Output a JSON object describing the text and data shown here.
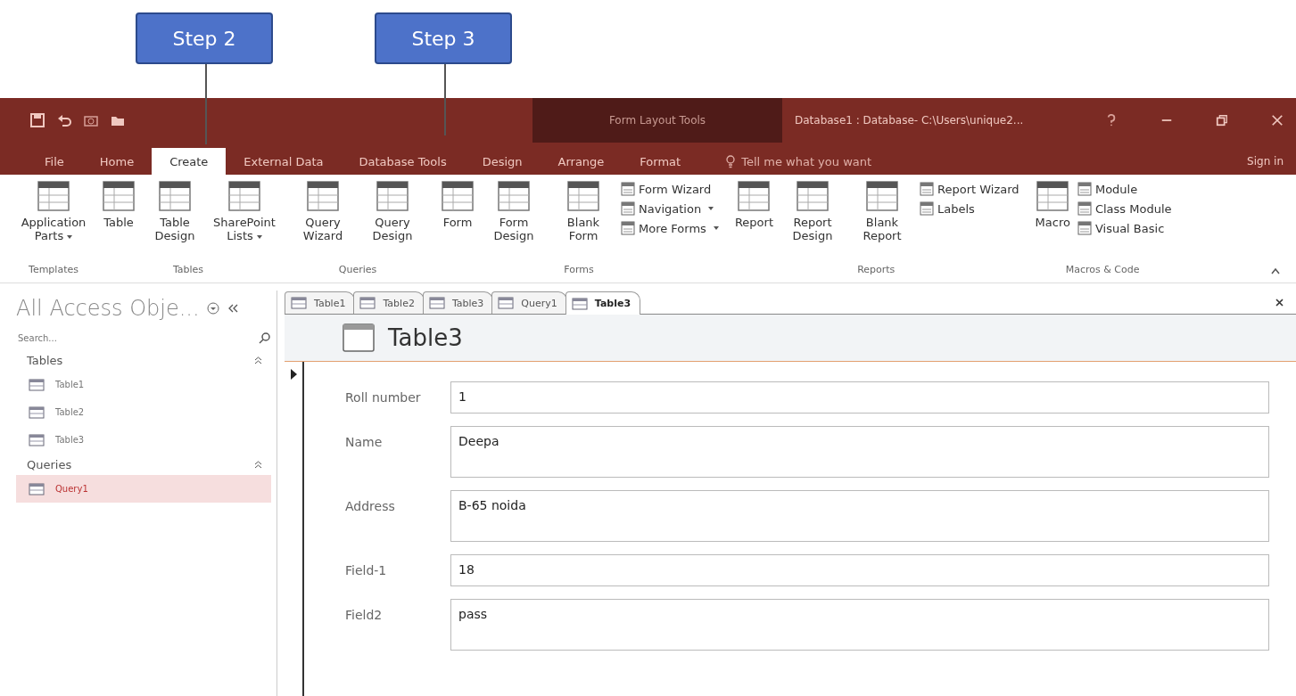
{
  "callouts": [
    {
      "label": "Step 2"
    },
    {
      "label": "Step 3"
    }
  ],
  "context_title": "Form Layout Tools",
  "window": {
    "title": "Database1 : Database- C:\\Users\\unique2..."
  },
  "ribbon_tabs": [
    {
      "label": "File",
      "selected": false
    },
    {
      "label": "Home",
      "selected": false
    },
    {
      "label": "Create",
      "selected": true
    },
    {
      "label": "External Data",
      "selected": false
    },
    {
      "label": "Database Tools",
      "selected": false
    },
    {
      "label": "Design",
      "selected": false
    },
    {
      "label": "Arrange",
      "selected": false
    },
    {
      "label": "Format",
      "selected": false
    }
  ],
  "tell_me": {
    "placeholder": "Tell me what you want"
  },
  "sign_in": "Sign in",
  "ribbon_groups": [
    {
      "label": "Templates",
      "commands": [
        {
          "kind": "large",
          "label": "Application Parts",
          "dropdown": true
        }
      ]
    },
    {
      "label": "Tables",
      "commands": [
        {
          "kind": "large",
          "label": "Table",
          "dropdown": false
        },
        {
          "kind": "large",
          "label": "Table Design",
          "dropdown": false
        },
        {
          "kind": "large",
          "label": "SharePoint Lists",
          "dropdown": true
        }
      ]
    },
    {
      "label": "Queries",
      "commands": [
        {
          "kind": "large",
          "label": "Query Wizard",
          "dropdown": false
        },
        {
          "kind": "large",
          "label": "Query Design",
          "dropdown": false
        }
      ]
    },
    {
      "label": "Forms",
      "commands": [
        {
          "kind": "large",
          "label": "Form",
          "dropdown": false
        },
        {
          "kind": "large",
          "label": "Form Design",
          "dropdown": false
        },
        {
          "kind": "large",
          "label": "Blank Form",
          "dropdown": false
        },
        {
          "kind": "small",
          "label": "Form Wizard",
          "dropdown": false
        },
        {
          "kind": "small",
          "label": "Navigation",
          "dropdown": true
        },
        {
          "kind": "small",
          "label": "More Forms",
          "dropdown": true
        }
      ]
    },
    {
      "label": "Reports",
      "commands": [
        {
          "kind": "large",
          "label": "Report",
          "dropdown": false
        },
        {
          "kind": "large",
          "label": "Report Design",
          "dropdown": false
        },
        {
          "kind": "large",
          "label": "Blank Report",
          "dropdown": false
        },
        {
          "kind": "small",
          "label": "Report Wizard",
          "dropdown": false
        },
        {
          "kind": "small",
          "label": "Labels",
          "dropdown": false
        }
      ]
    },
    {
      "label": "Macros & Code",
      "commands": [
        {
          "kind": "large",
          "label": "Macro",
          "dropdown": false
        },
        {
          "kind": "small",
          "label": "Module",
          "dropdown": false
        },
        {
          "kind": "small",
          "label": "Class Module",
          "dropdown": false
        },
        {
          "kind": "small",
          "label": "Visual Basic",
          "dropdown": false
        }
      ]
    }
  ],
  "nav_pane": {
    "title": "All Access Obje...",
    "search": {
      "placeholder": "Search..."
    },
    "groups": [
      {
        "label": "Tables",
        "expanded": true,
        "items": [
          {
            "label": "Table1",
            "selected": false
          },
          {
            "label": "Table2",
            "selected": false
          },
          {
            "label": "Table3",
            "selected": false
          }
        ]
      },
      {
        "label": "Queries",
        "expanded": true,
        "items": [
          {
            "label": "Query1",
            "selected": true
          }
        ]
      }
    ]
  },
  "doc_tabs": [
    {
      "label": "Table1",
      "selected": false
    },
    {
      "label": "Table2",
      "selected": false
    },
    {
      "label": "Table3",
      "selected": false
    },
    {
      "label": "Query1",
      "selected": false
    },
    {
      "label": "Table3",
      "selected": true
    }
  ],
  "form": {
    "title": "Table3",
    "fields": [
      {
        "label": "Roll number",
        "value": "1",
        "tall": false
      },
      {
        "label": "Name",
        "value": "Deepa",
        "tall": true
      },
      {
        "label": "Address",
        "value": "B-65 noida",
        "tall": true
      },
      {
        "label": "Field-1",
        "value": "18",
        "tall": false
      },
      {
        "label": "Field2",
        "value": "pass",
        "tall": true
      }
    ]
  }
}
